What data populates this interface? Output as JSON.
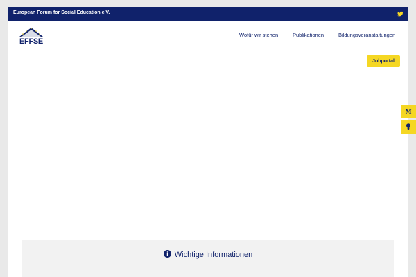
{
  "topbar": {
    "title": "European Forum for Social Education e.V.",
    "social_icon": "twitter-icon"
  },
  "logo": {
    "text": "EFFSE"
  },
  "nav": {
    "items": [
      {
        "label": "Wofür wir stehen"
      },
      {
        "label": "Publikationen"
      },
      {
        "label": "Bildungsveranstaltungen"
      }
    ],
    "jobportal_label": "Jobportal"
  },
  "side_buttons": {
    "m_label": "M",
    "bulb_icon": "lightbulb-icon"
  },
  "info": {
    "heading": "Wichtige Informationen",
    "icon": "info-circle-icon"
  },
  "colors": {
    "brand_navy": "#10226b",
    "accent_yellow": "#f5d723",
    "background": "#e9e9e9",
    "info_box": "#f2f2f2"
  }
}
